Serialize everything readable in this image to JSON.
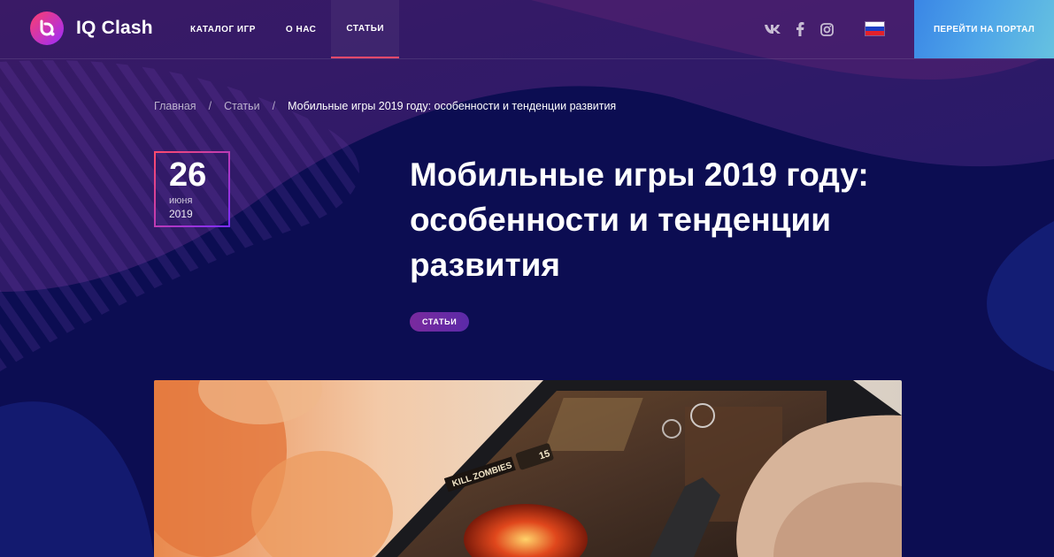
{
  "brand": {
    "name": "IQ Clash"
  },
  "nav": [
    {
      "label": "КАТАЛОГ ИГР",
      "active": false
    },
    {
      "label": "О НАС",
      "active": false
    },
    {
      "label": "СТАТЬИ",
      "active": true
    }
  ],
  "social": [
    "vk-icon",
    "facebook-icon",
    "instagram-icon"
  ],
  "language": {
    "flag": "russia-flag-icon"
  },
  "portal_button": "ПЕРЕЙТИ НА ПОРТАЛ",
  "breadcrumb": {
    "home": "Главная",
    "section": "Статьи",
    "current": "Мобильные игры 2019 году: особенности и тенденции развития",
    "separator": "/"
  },
  "article": {
    "date": {
      "day": "26",
      "month": "июня",
      "year": "2019"
    },
    "title_lines": [
      "Мобильные игры 2019 году:",
      "особенности и тенденции",
      "развития"
    ],
    "tag": "СТАТЬИ",
    "image": {
      "in_game_text": "KILL ZOMBIES",
      "in_game_counter": "15"
    }
  },
  "colors": {
    "background": "#0c0d52",
    "accent": "#ff4a6b",
    "tag": "#6a2aa3",
    "portal": "#4fa6e8"
  }
}
